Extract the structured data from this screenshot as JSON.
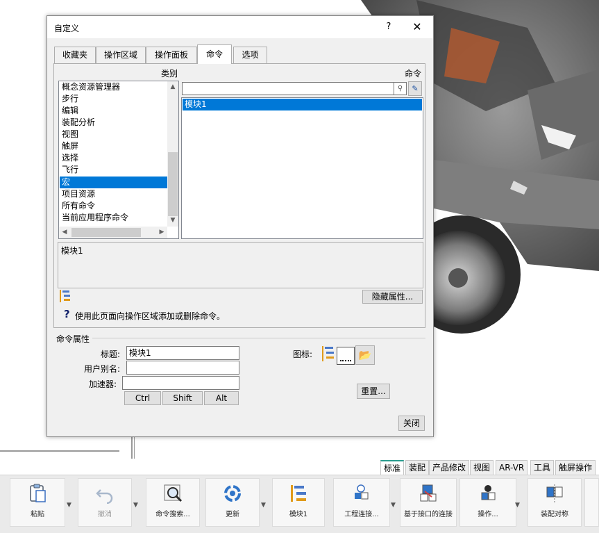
{
  "dialog": {
    "title": "自定义",
    "help_glyph": "?",
    "close_glyph": "✕",
    "tabs": [
      {
        "label": "收藏夹",
        "active": false
      },
      {
        "label": "操作区域",
        "active": false
      },
      {
        "label": "操作面板",
        "active": false
      },
      {
        "label": "命令",
        "active": true
      },
      {
        "label": "选项",
        "active": false
      }
    ],
    "category_label": "类别",
    "command_label": "命令",
    "categories": [
      "概念资源管理器",
      "步行",
      "编辑",
      "装配分析",
      "视图",
      "触屏",
      "选择",
      "飞行",
      "宏",
      "项目资源",
      "所有命令",
      "当前应用程序命令"
    ],
    "selected_category": "宏",
    "search": {
      "value": "",
      "placeholder": ""
    },
    "commands": [
      "模块1"
    ],
    "selected_command": "模块1",
    "description": "模块1",
    "hide_properties_button": "隐藏属性...",
    "hint_text": "使用此页面向操作区域添加或删除命令。",
    "properties": {
      "legend": "命令属性",
      "title_label": "标题:",
      "title_value": "模块1",
      "alias_label": "用户别名:",
      "alias_value": "",
      "accelerator_label": "加速器:",
      "accelerator_value": "",
      "ctrl": "Ctrl",
      "shift": "Shift",
      "alt": "Alt",
      "icon_label": "图标:",
      "reset_button": "重置..."
    },
    "close_button": "关闭"
  },
  "ribbon": {
    "tabs": [
      {
        "label": "标准",
        "active": true
      },
      {
        "label": "装配",
        "active": false
      },
      {
        "label": "产品修改",
        "active": false
      },
      {
        "label": "视图",
        "active": false
      },
      {
        "label": "AR-VR",
        "active": false
      },
      {
        "label": "工具",
        "active": false
      },
      {
        "label": "触屏操作",
        "active": false
      }
    ],
    "buttons": [
      {
        "label": "粘贴",
        "icon": "paste-icon",
        "enabled": true
      },
      {
        "label": "撤消",
        "icon": "undo-icon",
        "enabled": false
      },
      {
        "label": "命令搜索...",
        "icon": "command-search-icon",
        "enabled": true
      },
      {
        "label": "更新",
        "icon": "update-icon",
        "enabled": true
      },
      {
        "label": "模块1",
        "icon": "macro-module-icon",
        "enabled": true
      },
      {
        "label": "工程连接...",
        "icon": "engineering-connection-icon",
        "enabled": true
      },
      {
        "label": "基于接口的连接",
        "icon": "interface-connection-icon",
        "enabled": true
      },
      {
        "label": "操作...",
        "icon": "manipulate-icon",
        "enabled": true
      },
      {
        "label": "装配对称",
        "icon": "assembly-symmetry-icon",
        "enabled": true
      }
    ]
  },
  "colors": {
    "selection": "#0078d7",
    "dialog_bg": "#f0f0f0",
    "active_tab_accent": "#2a9d8f"
  }
}
